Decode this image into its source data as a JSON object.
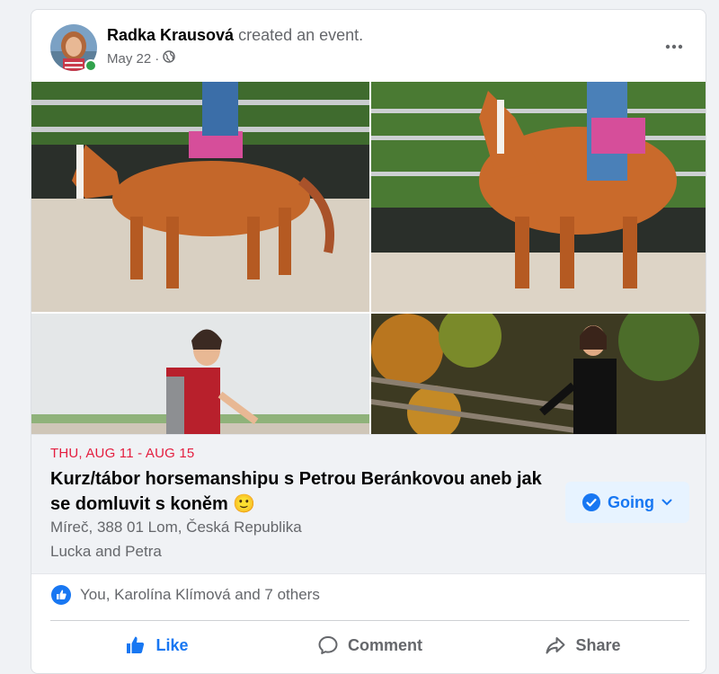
{
  "post": {
    "author": "Radka Krausová",
    "action_text": " created an event.",
    "date": "May 22",
    "privacy_separator": " · ",
    "more_label": "•••"
  },
  "event": {
    "date_range": "THU, AUG 11 - AUG 15",
    "title": "Kurz/tábor horsemanshipu s Petrou Beránkovou aneb jak se domluvit s koněm 🙂",
    "location": "Míreč, 388 01 Lom, Česká Republika",
    "hosts": "Lucka and Petra",
    "rsvp_label": "Going"
  },
  "reactions": {
    "text": "You, Karolína Klímová and 7 others"
  },
  "actions": {
    "like": "Like",
    "comment": "Comment",
    "share": "Share"
  },
  "colors": {
    "accent": "#1877f2",
    "date_red": "#e41e3f",
    "online_green": "#31a24c"
  }
}
